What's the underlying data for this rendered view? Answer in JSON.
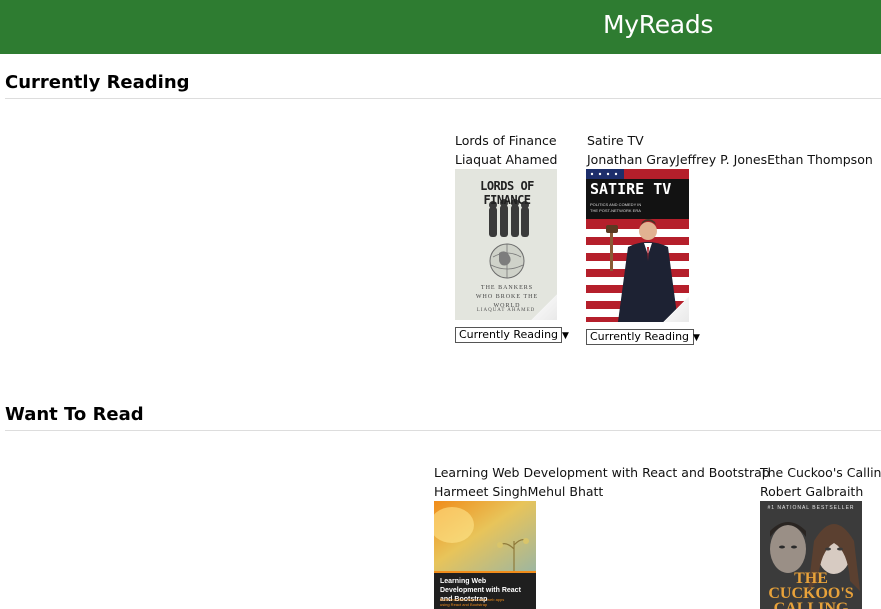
{
  "header": {
    "title": "MyReads"
  },
  "shelves": [
    {
      "title": "Currently Reading",
      "books": [
        {
          "title": "Lords of Finance",
          "authors": "Liaquat Ahamed",
          "cover": {
            "title_text": "LORDS OF FINANCE",
            "subtitle_text": "THE BANKERS WHO BROKE THE WORLD",
            "author_text": "LIAQUAT AHAMED"
          },
          "shelf_value": "Currently Reading"
        },
        {
          "title": "Satire TV",
          "authors": "Jonathan GrayJeffrey P. JonesEthan Thompson",
          "cover": {
            "title_text": "SATIRE TV",
            "subtitle_text": "POLITICS AND COMEDY IN THE POST-NETWORK ERA"
          },
          "shelf_value": "Currently Reading"
        }
      ]
    },
    {
      "title": "Want To Read",
      "books": [
        {
          "title": "Learning Web Development with React and Bootstrap",
          "authors": "Harmeet SinghMehul Bhatt",
          "cover": {
            "title_text": "Learning Web Development with React and Bootstrap",
            "subtitle_text": "Build real-time responsive web apps using React and Bootstrap"
          }
        },
        {
          "title": "The Cuckoo's Calling",
          "authors": "Robert Galbraith",
          "cover": {
            "top_text": "#1 NATIONAL BESTSELLER",
            "title_text": "THE CUCKOO'S CALLING"
          }
        }
      ]
    }
  ],
  "colors": {
    "header": "#2e7c31",
    "rule": "#dddddd"
  }
}
